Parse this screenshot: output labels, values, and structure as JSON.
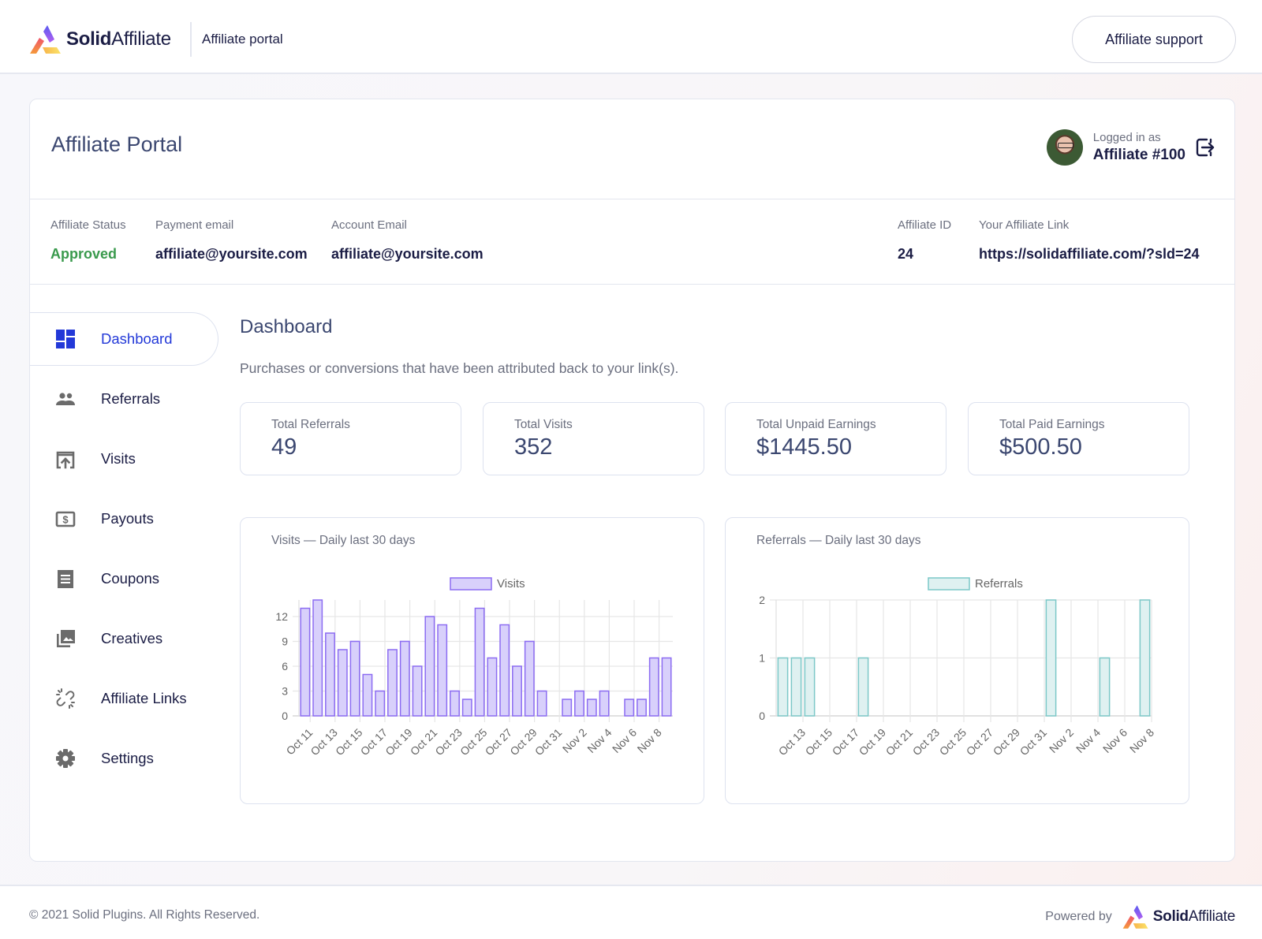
{
  "topbar": {
    "brand_bold": "Solid",
    "brand_light": "Affiliate",
    "portal_label": "Affiliate portal",
    "support_button": "Affiliate support"
  },
  "header": {
    "title": "Affiliate Portal",
    "logged_in_label": "Logged in as",
    "user_name": "Affiliate #100",
    "logout_icon": "logout-icon"
  },
  "info": {
    "status_label": "Affiliate Status",
    "status_value": "Approved",
    "payment_email_label": "Payment email",
    "payment_email_value": "affiliate@yoursite.com",
    "account_email_label": "Account Email",
    "account_email_value": "affiliate@yoursite.com",
    "affiliate_id_label": "Affiliate ID",
    "affiliate_id_value": "24",
    "affiliate_link_label": "Your Affiliate Link",
    "affiliate_link_value": "https://solidaffiliate.com/?sld=24"
  },
  "sidebar": {
    "active": "Dashboard",
    "items": [
      {
        "label": "Dashboard",
        "icon": "dashboard-icon"
      },
      {
        "label": "Referrals",
        "icon": "people-icon"
      },
      {
        "label": "Visits",
        "icon": "visits-icon"
      },
      {
        "label": "Payouts",
        "icon": "payouts-icon"
      },
      {
        "label": "Coupons",
        "icon": "coupon-icon"
      },
      {
        "label": "Creatives",
        "icon": "images-icon"
      },
      {
        "label": "Affiliate Links",
        "icon": "link-icon"
      },
      {
        "label": "Settings",
        "icon": "gear-icon"
      }
    ]
  },
  "dashboard": {
    "title": "Dashboard",
    "description": "Purchases or conversions that have been attributed back to your link(s).",
    "stats": [
      {
        "label": "Total Referrals",
        "value": "49"
      },
      {
        "label": "Total Visits",
        "value": "352"
      },
      {
        "label": "Total Unpaid Earnings",
        "value": "$1445.50"
      },
      {
        "label": "Total Paid Earnings",
        "value": "$500.50"
      }
    ]
  },
  "colors": {
    "accent": "#2339d8",
    "approved": "#3a9a4d",
    "visits_fill": "#d8d0fb",
    "visits_stroke": "#8c6cf2",
    "referrals_fill": "#dff1f1",
    "referrals_stroke": "#7cc8c8"
  },
  "chart_data": [
    {
      "type": "bar",
      "title": "Visits — Daily last 30 days",
      "legend": [
        "Visits"
      ],
      "legend_position": "top-center",
      "grid": true,
      "xlabel": "",
      "ylabel": "",
      "ylim": [
        0,
        14
      ],
      "yticks": [
        0,
        3,
        6,
        9,
        12
      ],
      "xtick_labels": [
        "Oct 11",
        "Oct 13",
        "Oct 15",
        "Oct 17",
        "Oct 19",
        "Oct 21",
        "Oct 23",
        "Oct 25",
        "Oct 27",
        "Oct 29",
        "Oct 31",
        "Nov 2",
        "Nov 4",
        "Nov 6",
        "Nov 8"
      ],
      "categories": [
        "Oct 11",
        "Oct 12",
        "Oct 13",
        "Oct 14",
        "Oct 15",
        "Oct 16",
        "Oct 17",
        "Oct 18",
        "Oct 19",
        "Oct 20",
        "Oct 21",
        "Oct 22",
        "Oct 23",
        "Oct 24",
        "Oct 25",
        "Oct 26",
        "Oct 27",
        "Oct 28",
        "Oct 29",
        "Oct 30",
        "Oct 31",
        "Nov 1",
        "Nov 2",
        "Nov 3",
        "Nov 4",
        "Nov 5",
        "Nov 6",
        "Nov 7",
        "Nov 8",
        "Nov 9"
      ],
      "series": [
        {
          "name": "Visits",
          "values": [
            13,
            14,
            10,
            8,
            9,
            5,
            3,
            8,
            9,
            6,
            12,
            11,
            3,
            2,
            13,
            7,
            11,
            6,
            9,
            3,
            0,
            2,
            3,
            2,
            3,
            0,
            2,
            2,
            7,
            7
          ]
        }
      ]
    },
    {
      "type": "bar",
      "title": "Referrals — Daily last 30 days",
      "legend": [
        "Referrals"
      ],
      "legend_position": "top-center",
      "grid": true,
      "xlabel": "",
      "ylabel": "",
      "ylim": [
        0,
        2
      ],
      "yticks": [
        0,
        1,
        2
      ],
      "xtick_labels": [
        "Oct 13",
        "Oct 15",
        "Oct 17",
        "Oct 19",
        "Oct 21",
        "Oct 23",
        "Oct 25",
        "Oct 27",
        "Oct 29",
        "Oct 31",
        "Nov 2",
        "Nov 4",
        "Nov 6",
        "Nov 8"
      ],
      "categories": [
        "Oct 12",
        "Oct 13",
        "Oct 14",
        "Oct 15",
        "Oct 16",
        "Oct 17",
        "Oct 18",
        "Oct 19",
        "Oct 20",
        "Oct 21",
        "Oct 22",
        "Oct 23",
        "Oct 24",
        "Oct 25",
        "Oct 26",
        "Oct 27",
        "Oct 28",
        "Oct 29",
        "Oct 30",
        "Oct 31",
        "Nov 1",
        "Nov 2",
        "Nov 3",
        "Nov 4",
        "Nov 5",
        "Nov 6",
        "Nov 7",
        "Nov 8"
      ],
      "series": [
        {
          "name": "Referrals",
          "values": [
            1,
            1,
            1,
            0,
            0,
            0,
            1,
            0,
            0,
            0,
            0,
            0,
            0,
            0,
            0,
            0,
            0,
            0,
            0,
            0,
            2,
            0,
            0,
            0,
            1,
            0,
            0,
            2
          ]
        }
      ]
    }
  ],
  "footer": {
    "copyright": "© 2021 Solid Plugins. All Rights Reserved.",
    "powered_by": "Powered by",
    "brand_bold": "Solid",
    "brand_light": "Affiliate"
  }
}
